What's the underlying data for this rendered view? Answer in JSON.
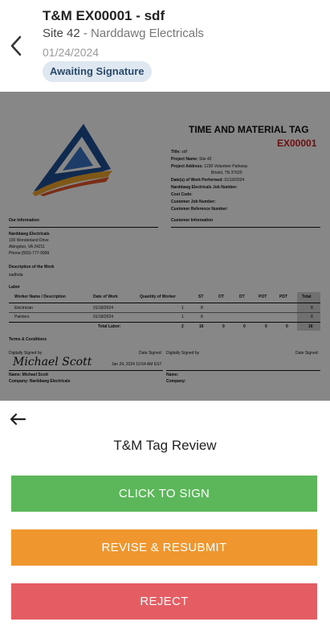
{
  "header": {
    "title": "T&M EX00001 - sdf",
    "site": "Site 42",
    "separator": " - ",
    "company": "Narddawg Electricals",
    "date": "01/24/2024",
    "status": "Awaiting Signature"
  },
  "document": {
    "heading": "TIME AND MATERIAL TAG",
    "number": "EX00001",
    "fields": [
      {
        "label": "Title:",
        "value": "sdf"
      },
      {
        "label": "Project Name:",
        "value": "Site 42"
      },
      {
        "label": "Project Address:",
        "value": "1230 Volunteer Parkway"
      },
      {
        "label": "",
        "value": "Bristol, TN 37620"
      },
      {
        "label": "Date(s) of Work Performed:",
        "value": "01/18/2024"
      },
      {
        "label": "Narddawg Electricals Job Number:",
        "value": ""
      },
      {
        "label": "Cost Code:",
        "value": ""
      },
      {
        "label": "Customer Job Number:",
        "value": ""
      },
      {
        "label": "Customer Reference Number:",
        "value": ""
      }
    ],
    "our_info_label": "Our Information",
    "customer_info_label": "Customer Information",
    "company_name": "Narddawg Electricals",
    "address_1": "100 Wonderland Drive",
    "address_2": "Abingdon, VA 24211",
    "phone": "Phone:(555)-777-9999",
    "description_label": "Description of the Work",
    "description_value": "sadfsda",
    "labor_label": "Labor",
    "labor_headers": [
      "Worker Name / Description",
      "Date of Work",
      "Quantity of Worker",
      "ST",
      "OT",
      "DT",
      "POT",
      "PDT",
      "Total"
    ],
    "labor_rows": [
      [
        "Electrician",
        "01/18/2024",
        "1",
        "8",
        "",
        "",
        "",
        "",
        "8"
      ],
      [
        "Painters",
        "01/18/2024",
        "1",
        "8",
        "",
        "",
        "",
        "",
        "8"
      ]
    ],
    "total_label": "Total Labor:",
    "total_row": [
      "2",
      "16",
      "0",
      "0",
      "0",
      "0",
      "16"
    ],
    "terms_label": "Terms & Conditions",
    "digitally_signed_by": "Digitally Signed by",
    "date_signed": "Date Signed:",
    "signature": "Michael Scott",
    "signed_timestamp": "Jan 24, 2024 10:54 AM EST",
    "signer_name": "Name: Michael Scott",
    "signer_company": "Company: Narddawg Electricals",
    "name_label": "Name:",
    "company_label": "Company:"
  },
  "panel": {
    "title": "T&M Tag Review",
    "sign_label": "CLICK TO SIGN",
    "revise_label": "REVISE & RESUBMIT",
    "reject_label": "REJECT"
  },
  "colors": {
    "sign": "#5cb75a",
    "revise": "#f0962e",
    "reject": "#e35d63",
    "badge_bg": "#dfe8f1",
    "tag_number": "#cc1d1d"
  },
  "icons": {
    "header_back": "chevron-left-icon",
    "panel_back": "arrow-left-icon",
    "logo": "triangle-logo"
  }
}
